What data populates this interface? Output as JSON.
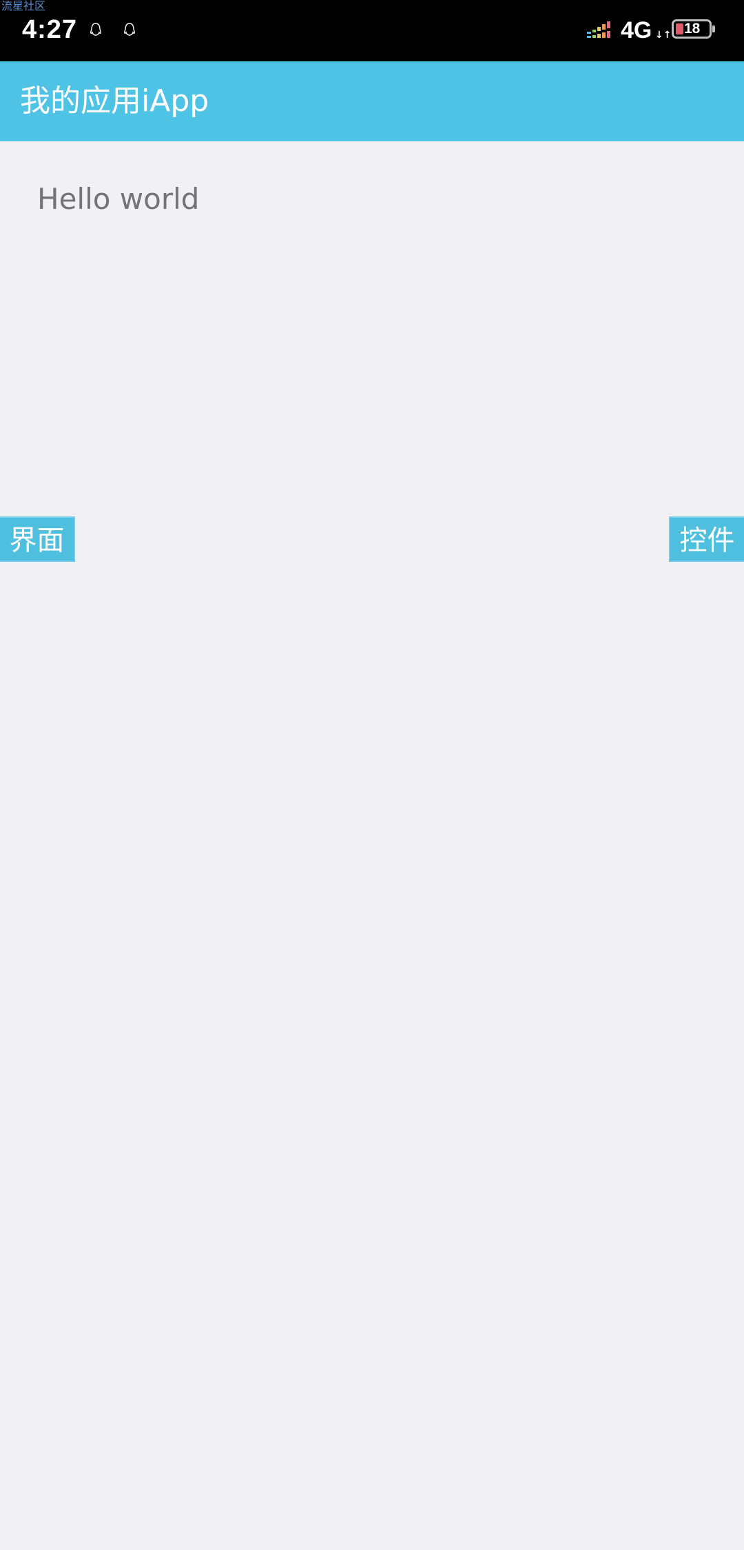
{
  "status_bar": {
    "overlay_tag": "流星社区",
    "time": "4:27",
    "network": "4G",
    "network_arrows": "↓↑",
    "battery_level": "18",
    "icons": [
      "qq-penguin-icon",
      "qq-penguin-icon",
      "signal-strength-icon",
      "battery-icon"
    ]
  },
  "app_bar": {
    "title": "我的应用iApp"
  },
  "content": {
    "text": "Hello world"
  },
  "side_buttons": {
    "left_label": "界面",
    "right_label": "控件"
  },
  "colors": {
    "status_bar_bg": "#000000",
    "app_bar_bg": "#4fc3e5",
    "page_bg": "#f1f0f5",
    "button_bg": "#4fbfe0",
    "text_gray": "#747378",
    "battery_low": "#e05a6e"
  }
}
